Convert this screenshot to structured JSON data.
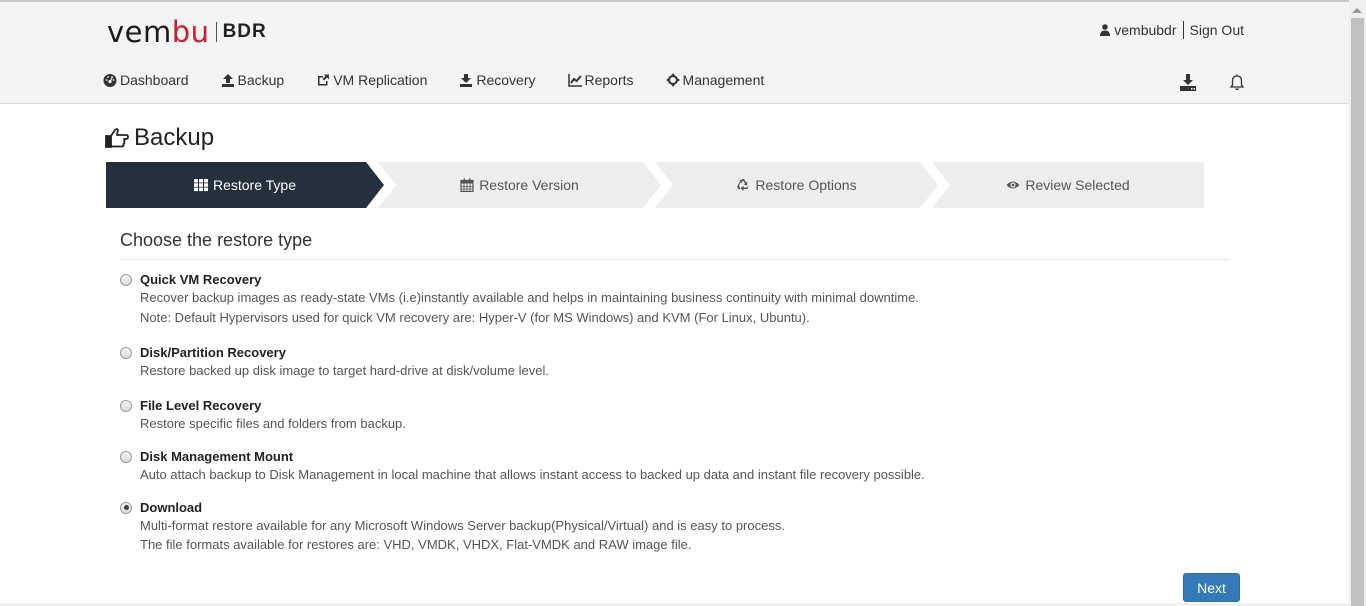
{
  "header": {
    "logo": {
      "part1": "vem",
      "part2": "bu",
      "product": "BDR"
    },
    "user": {
      "name": "vembubdr",
      "sign_out": "Sign Out"
    },
    "nav": [
      {
        "label": "Dashboard",
        "icon": "dashboard-icon"
      },
      {
        "label": "Backup",
        "icon": "upload-icon"
      },
      {
        "label": "VM Replication",
        "icon": "share-icon"
      },
      {
        "label": "Recovery",
        "icon": "download-icon"
      },
      {
        "label": "Reports",
        "icon": "chart-icon"
      },
      {
        "label": "Management",
        "icon": "crosshair-icon"
      }
    ],
    "icons": [
      "download-tray-icon",
      "bell-icon"
    ]
  },
  "page": {
    "title": "Backup",
    "title_icon": "hand-pointer-icon"
  },
  "steps": [
    {
      "label": "Restore Type",
      "icon": "grid-icon",
      "active": true
    },
    {
      "label": "Restore Version",
      "icon": "calendar-icon",
      "active": false
    },
    {
      "label": "Restore Options",
      "icon": "recycle-icon",
      "active": false
    },
    {
      "label": "Review Selected",
      "icon": "eye-icon",
      "active": false
    }
  ],
  "section": {
    "title": "Choose the restore type",
    "options": [
      {
        "title": "Quick VM Recovery",
        "checked": false,
        "desc": [
          "Recover backup images as ready-state VMs (i.e)instantly available and helps in maintaining business continuity with minimal downtime.",
          "Note: Default Hypervisors used for quick VM recovery are: Hyper-V (for MS Windows) and KVM (For Linux, Ubuntu)."
        ]
      },
      {
        "title": "Disk/Partition Recovery",
        "checked": false,
        "desc": [
          "Restore backed up disk image to target hard-drive at disk/volume level."
        ]
      },
      {
        "title": "File Level Recovery",
        "checked": false,
        "desc": [
          "Restore specific files and folders from backup."
        ]
      },
      {
        "title": "Disk Management Mount",
        "checked": false,
        "desc": [
          "Auto attach backup to Disk Management in local machine that allows instant access to backed up data and instant file recovery possible."
        ]
      },
      {
        "title": "Download",
        "checked": true,
        "desc": [
          "Multi-format restore available for any Microsoft Windows Server backup(Physical/Virtual) and is easy to process.",
          "The file formats available for restores are: VHD, VMDK, VHDX, Flat-VMDK and RAW image file."
        ]
      }
    ]
  },
  "actions": {
    "next": "Next"
  },
  "colors": {
    "active_step": "#25303d",
    "inactive_step": "#eeeeee",
    "primary": "#337ab7",
    "logo_red": "#c8202f"
  }
}
